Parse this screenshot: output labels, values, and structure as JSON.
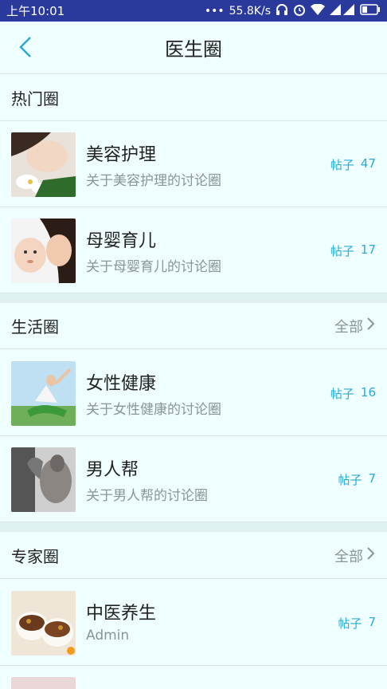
{
  "status": {
    "time": "上午10:01",
    "speed": "55.8K/s",
    "icons": [
      "ellipsis-icon",
      "headphones-icon",
      "alarm-icon",
      "wifi-icon",
      "signal-icon",
      "battery-icon"
    ]
  },
  "nav": {
    "title": "医生圈",
    "back_icon": "chevron-left-icon"
  },
  "hot": {
    "label": "热门圈",
    "items": [
      {
        "name": "美容护理",
        "desc": "关于美容护理的讨论圈",
        "count_label": "帖子",
        "count": "47",
        "image": "beauty-photo"
      },
      {
        "name": "母婴育儿",
        "desc": "关于母婴育儿的讨论圈",
        "count_label": "帖子",
        "count": "17",
        "image": "mother-baby-photo"
      }
    ]
  },
  "life": {
    "label": "生活圈",
    "more": "全部",
    "items": [
      {
        "name": "女性健康",
        "desc": "关于女性健康的讨论圈",
        "count_label": "帖子",
        "count": "16",
        "image": "yoga-photo"
      },
      {
        "name": "男人帮",
        "desc": "关于男人帮的讨论圈",
        "count_label": "帖子",
        "count": "7",
        "image": "muscle-man-photo"
      }
    ]
  },
  "expert": {
    "label": "专家圈",
    "more": "全部",
    "items": [
      {
        "name": "中医养生",
        "desc": "Admin",
        "count_label": "帖子",
        "count": "7",
        "image": "herbal-soup-photo"
      }
    ]
  },
  "colors": {
    "accent": "#2aa9d6",
    "statusbar": "#2a3a9c",
    "background": "#eefcfd"
  }
}
